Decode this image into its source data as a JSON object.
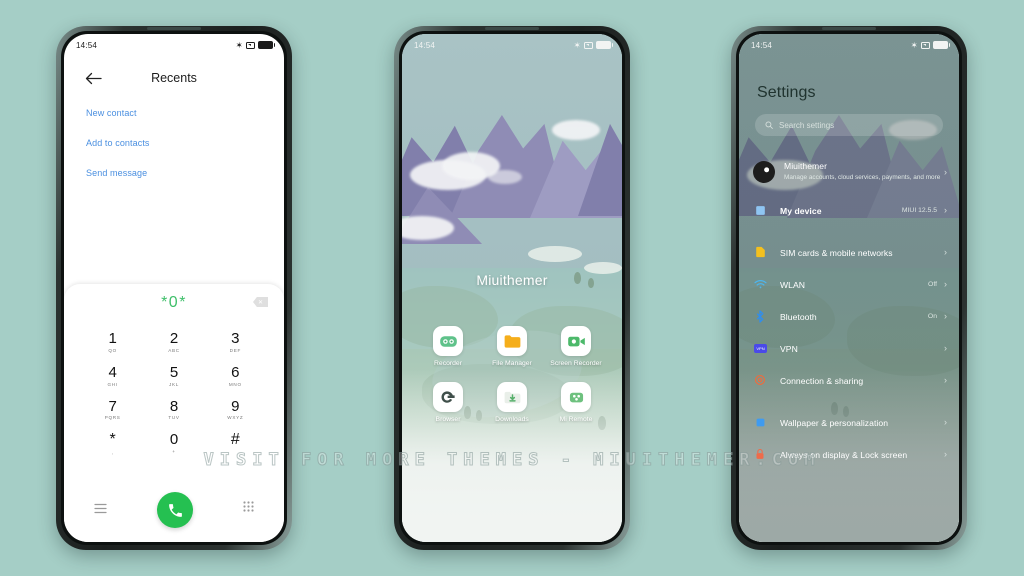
{
  "background_color": "#a5cec6",
  "watermark": "VISIT FOR MORE THEMES - MIUITHEMER.COM",
  "status_bar": {
    "time": "14:54",
    "bluetooth_icon": "bluetooth-icon",
    "alarm_icon": "alarm-icon",
    "battery_icon": "battery-icon"
  },
  "dialer": {
    "title": "Recents",
    "back_icon": "back-arrow-icon",
    "actions": [
      "New contact",
      "Add to contacts",
      "Send message"
    ],
    "number": "*0*",
    "backspace_icon": "backspace-icon",
    "keys": [
      {
        "digit": "1",
        "letters": "QO"
      },
      {
        "digit": "2",
        "letters": "ABC"
      },
      {
        "digit": "3",
        "letters": "DEF"
      },
      {
        "digit": "4",
        "letters": "GHI"
      },
      {
        "digit": "5",
        "letters": "JKL"
      },
      {
        "digit": "6",
        "letters": "MNO"
      },
      {
        "digit": "7",
        "letters": "PQRS"
      },
      {
        "digit": "8",
        "letters": "TUV"
      },
      {
        "digit": "9",
        "letters": "WXYZ"
      },
      {
        "digit": "*",
        "letters": ","
      },
      {
        "digit": "0",
        "letters": "+"
      },
      {
        "digit": "#",
        "letters": ""
      }
    ],
    "call_button_color": "#25c051",
    "menu_icon": "menu-icon",
    "call_icon": "phone-call-icon",
    "keypad_icon": "keypad-grid-icon"
  },
  "home": {
    "widget_label": "Miuithemer",
    "apps": [
      {
        "name": "Recorder",
        "icon": "recorder-icon"
      },
      {
        "name": "File Manager",
        "icon": "file-manager-icon"
      },
      {
        "name": "Screen Recorder",
        "icon": "screen-recorder-icon"
      },
      {
        "name": "Browser",
        "icon": "browser-icon"
      },
      {
        "name": "Downloads",
        "icon": "downloads-icon"
      },
      {
        "name": "Mi Remote",
        "icon": "mi-remote-icon"
      }
    ]
  },
  "settings": {
    "title": "Settings",
    "search": {
      "placeholder": "Search settings",
      "icon": "search-icon"
    },
    "account": {
      "name": "Miuithemer",
      "subtitle": "Manage accounts, cloud services, payments, and more",
      "icon": "avatar"
    },
    "items": [
      {
        "label": "My device",
        "value": "MIUI 12.5.5",
        "icon": "device-icon",
        "bold": true
      },
      {
        "label": "SIM cards & mobile networks",
        "value": "",
        "icon": "sim-card-icon"
      },
      {
        "label": "WLAN",
        "value": "Off",
        "icon": "wifi-icon"
      },
      {
        "label": "Bluetooth",
        "value": "On",
        "icon": "bluetooth-icon"
      },
      {
        "label": "VPN",
        "value": "",
        "icon": "vpn-icon"
      },
      {
        "label": "Connection & sharing",
        "value": "",
        "icon": "connection-sharing-icon"
      },
      {
        "label": "Wallpaper & personalization",
        "value": "",
        "icon": "wallpaper-icon"
      },
      {
        "label": "Always-on display & Lock screen",
        "value": "",
        "icon": "lock-screen-icon"
      }
    ],
    "chevron_icon": "chevron-right-icon"
  }
}
